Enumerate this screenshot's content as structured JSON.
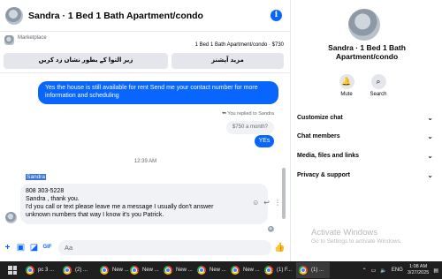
{
  "chat": {
    "title": "Sandra · 1 Bed 1 Bath Apartment/condo",
    "marketplace": {
      "label": "Marketplace",
      "listing": "1 Bed 1 Bath Apartment/condo · $730",
      "btn_mark_pending": "زیر التوا کے بطور نشان زد کریں",
      "btn_more_actions": "مزید آپشنز"
    },
    "messages": {
      "outgoing_1": "Yes the house is still available for rent Send me your contact number for more information and  scheduling",
      "replied_note": "You replied to Sandra",
      "quoted": "$750 a month?",
      "outgoing_2": "YEs",
      "timestamp": "12:39 AM",
      "sender_name": "Sandra",
      "incoming_lines": [
        "808 303-5228",
        "Sandra , thank you.",
        "I'd you call or text please leave me a message I usually don't answer",
        "unknown numbers that way I know it's you Patrick."
      ]
    },
    "composer": {
      "placeholder": "Aa"
    }
  },
  "info_pane": {
    "contact_name_line1": "Sandra · 1 Bed 1 Bath",
    "contact_name_line2": "Apartment/condo",
    "actions": {
      "mute": "Mute",
      "search": "Search"
    },
    "menu": [
      "Customize chat",
      "Chat members",
      "Media, files and links",
      "Privacy & support"
    ],
    "watermark_title": "Activate Windows",
    "watermark_sub": "Go to Settings to activate Windows."
  },
  "taskbar": {
    "items": [
      "pc 3 ...",
      "(2) ...",
      "New ...",
      "New ...",
      "New ...",
      "New ...",
      "New ...",
      "(1) F...",
      "(1) ..."
    ],
    "language": "ENG",
    "time": "1:08 AM",
    "date": "3/27/2025"
  },
  "icons": {
    "info": "info-icon",
    "mute": "bell-icon",
    "search": "search-icon",
    "like": "thumbs-up-icon"
  },
  "colors": {
    "accent": "#0866ff",
    "bubble_in": "#f0f2f5",
    "taskbar": "#1f1f1f"
  }
}
